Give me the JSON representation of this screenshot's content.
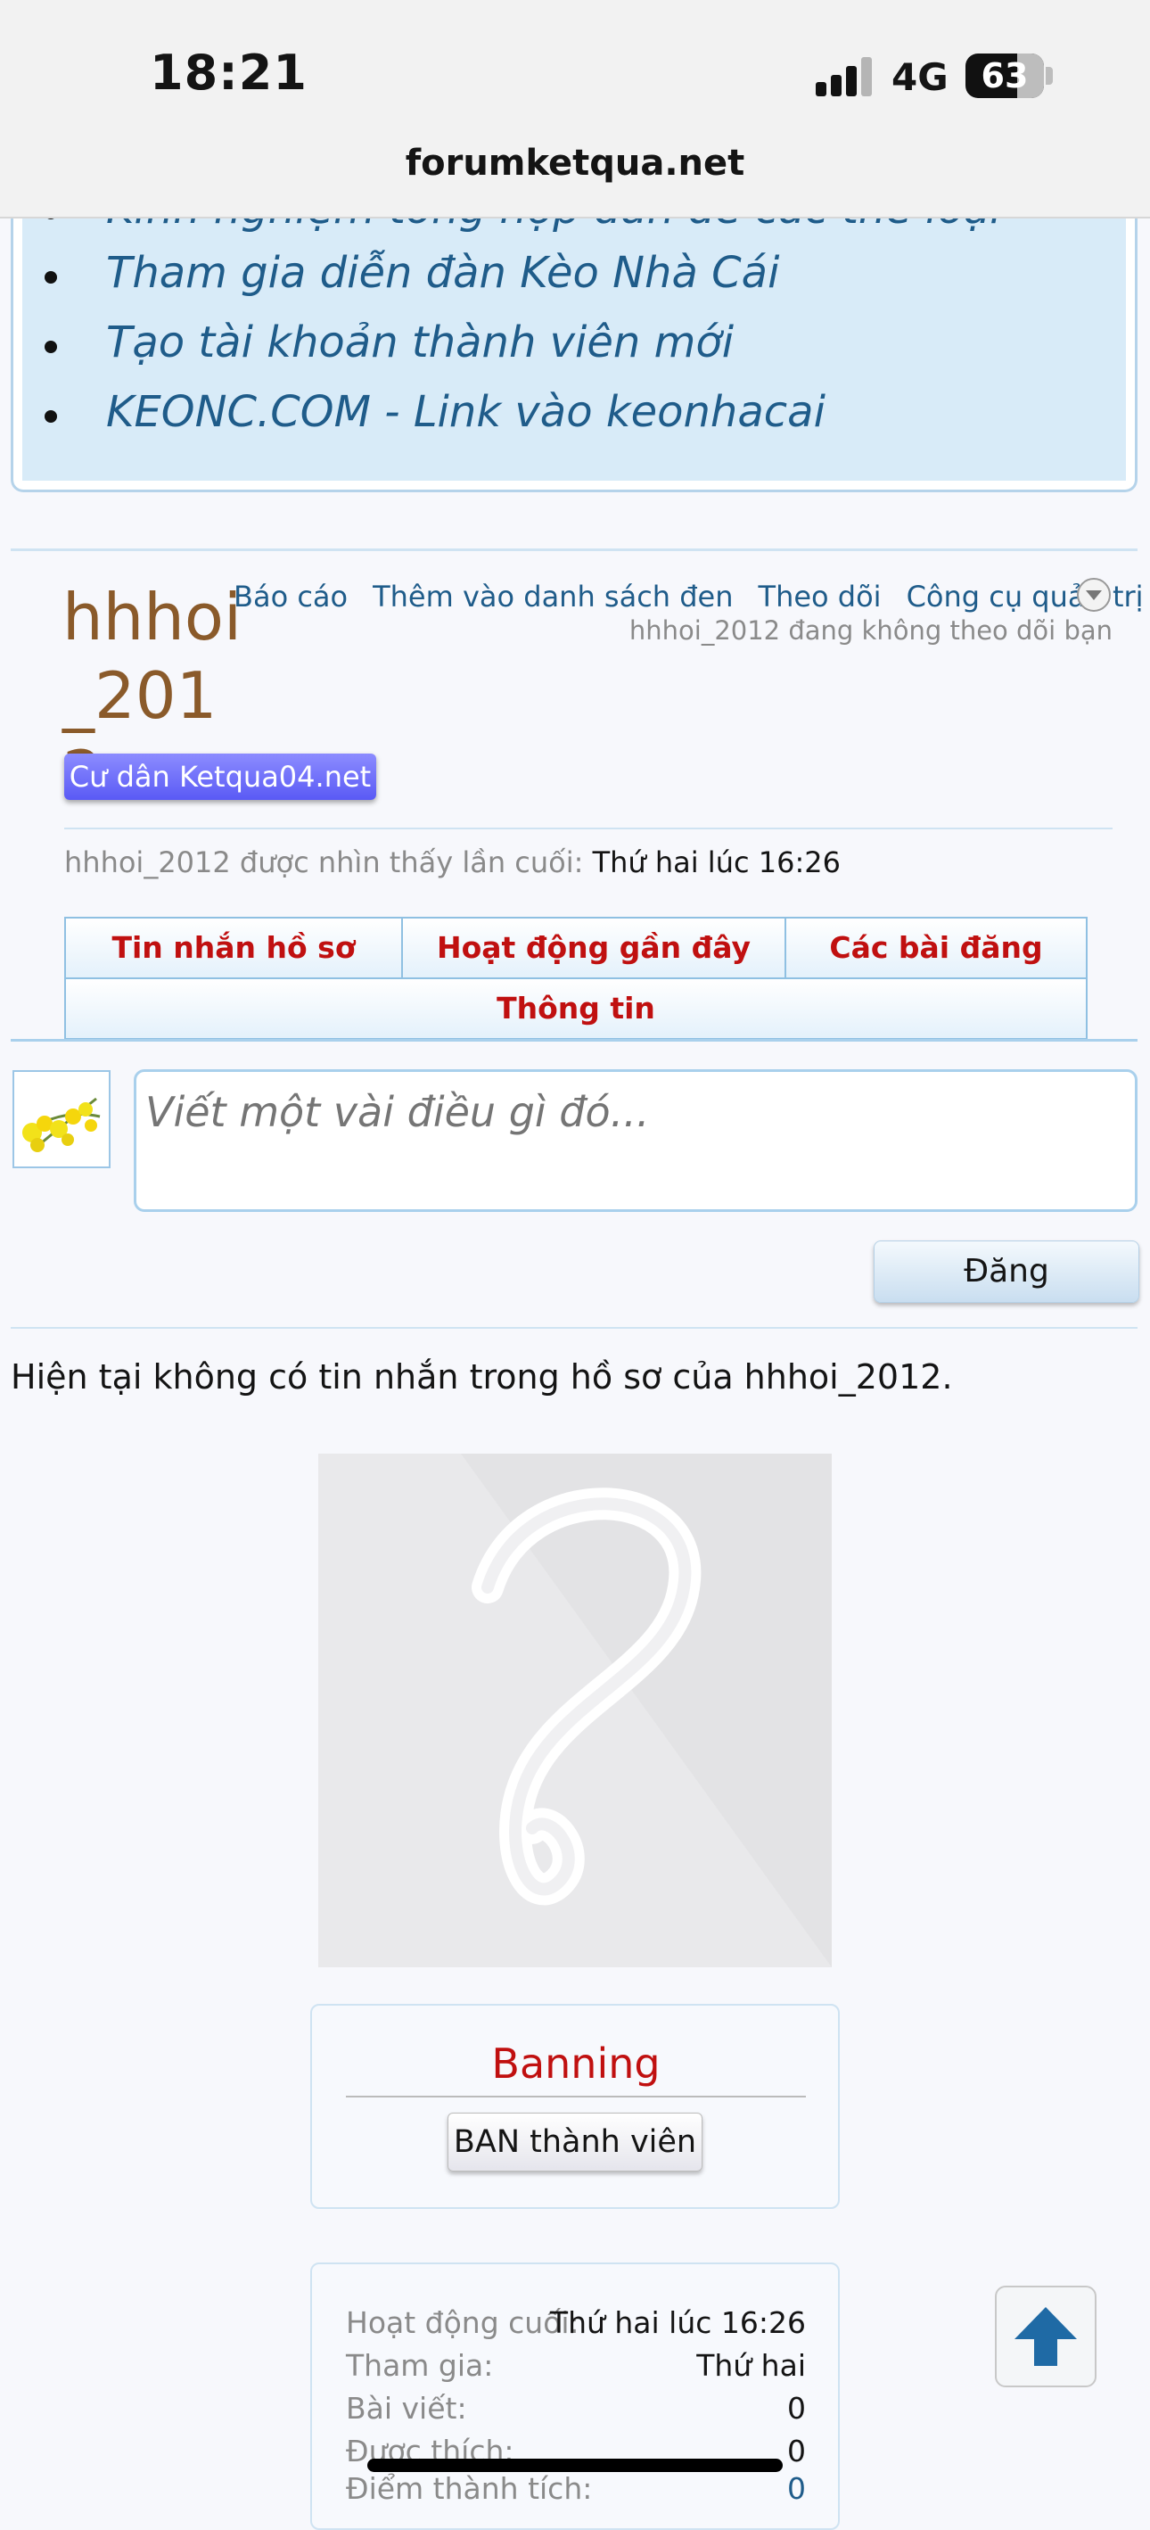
{
  "status_bar": {
    "time": "18:21",
    "network": "4G",
    "battery": "63"
  },
  "browser": {
    "url": "forumketqua.net"
  },
  "link_box": {
    "items": [
      "Kinh nghiệm tổng hợp dàn đề các thể loại",
      "Tham gia diễn đàn Kèo Nhà Cái",
      "Tạo tài khoản thành viên mới",
      "KEONC.COM - Link vào keonhacai"
    ]
  },
  "profile": {
    "username": "hhhoi_2012",
    "actions": [
      "Báo cáo",
      "Thêm vào danh sách đen",
      "Theo dõi",
      "Công cụ quản trị"
    ],
    "follow_note": "hhhoi_2012 đang không theo dõi bạn",
    "badge": "Cư dân Ketqua04.net",
    "last_seen_label": "hhhoi_2012 được nhìn thấy lần cuối:",
    "last_seen_value": "Thứ hai lúc 16:26"
  },
  "tabs": [
    "Tin nhắn hồ sơ",
    "Hoạt động gần đây",
    "Các bài đăng",
    "Thông tin"
  ],
  "message_form": {
    "placeholder": "Viết một vài điều gì đó...",
    "post_label": "Đăng"
  },
  "no_messages_text": "Hiện tại không có tin nhắn trong hồ sơ của hhhoi_2012.",
  "banning": {
    "title": "Banning",
    "button": "BAN thành viên"
  },
  "stats": [
    {
      "label": "Hoạt động cuối:",
      "value": "Thứ hai lúc 16:26"
    },
    {
      "label": "Tham gia:",
      "value": "Thứ hai"
    },
    {
      "label": "Bài viết:",
      "value": "0"
    },
    {
      "label": "Được thích:",
      "value": "0"
    },
    {
      "label": "Điểm thành tích:",
      "value": "0"
    }
  ],
  "colors": {
    "link": "#1f5c8a",
    "tab_text": "#c01010",
    "username": "#8a5a2a",
    "badge": "#6b6bf7"
  }
}
